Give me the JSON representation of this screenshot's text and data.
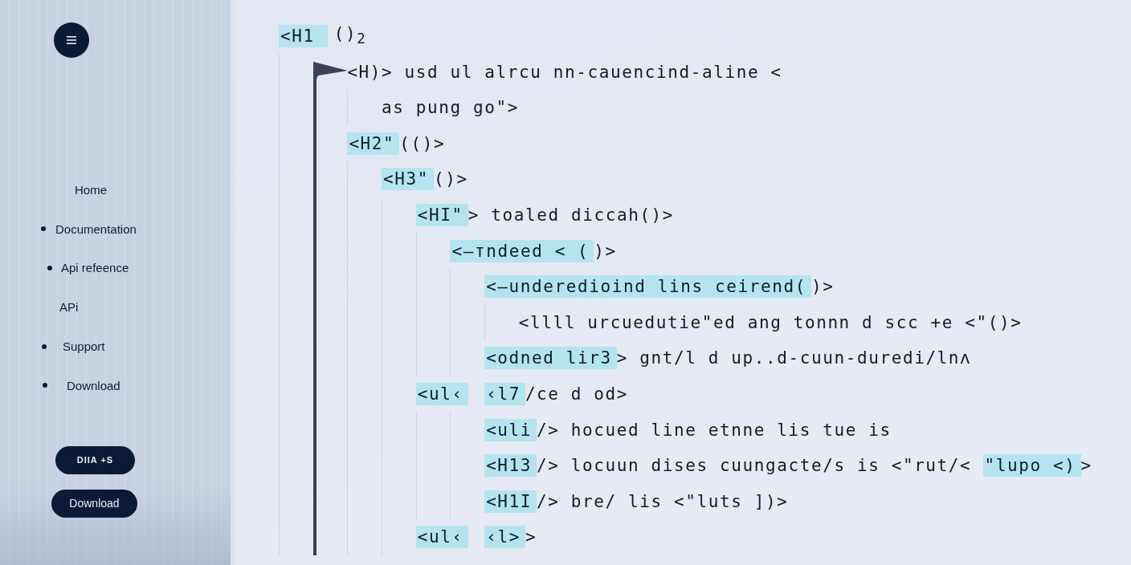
{
  "sidebar": {
    "nav": [
      {
        "label": "Home",
        "bullet": false
      },
      {
        "label": "Documentation",
        "bullet": true
      },
      {
        "label": "Api refeence",
        "bullet": true
      },
      {
        "label": "APi",
        "bullet": false
      },
      {
        "label": "Support",
        "bullet": true
      },
      {
        "label": "Download",
        "bullet": true
      }
    ],
    "buttons": [
      {
        "label": "DIIA +S"
      },
      {
        "label": "Download"
      }
    ]
  },
  "code": {
    "segments": [
      {
        "text": "<H1",
        "highlighted": true
      },
      {
        "text": "()$_{2}$",
        "highlighted": false
      }
    ],
    "children": [
      {
        "kind": "line",
        "segments": [
          {
            "text": "<H)> usd ul alrcu nn-cauencind-aline <",
            "highlighted": false
          }
        ],
        "children": [
          {
            "kind": "line",
            "segments": [
              {
                "text": "as pung go\">",
                "highlighted": false
              }
            ]
          }
        ]
      },
      {
        "kind": "line",
        "segments": [
          {
            "text": "<H2\"",
            "highlighted": true
          },
          {
            "text": "(()>",
            "highlighted": false
          }
        ],
        "children": [
          {
            "kind": "line",
            "segments": [
              {
                "text": "<H3\"",
                "highlighted": true
              },
              {
                "text": "()>",
                "highlighted": false
              }
            ],
            "children": [
              {
                "kind": "line",
                "segments": [
                  {
                    "text": "<HI\"",
                    "highlighted": true
                  },
                  {
                    "text": "> toaled diccah()>",
                    "highlighted": false
                  }
                ],
                "children": [
                  {
                    "kind": "line",
                    "segments": [
                      {
                        "text": "<—тndeed < (",
                        "highlighted": true
                      },
                      {
                        "text": ")>",
                        "highlighted": false
                      }
                    ],
                    "children": [
                      {
                        "kind": "line",
                        "segments": [
                          {
                            "text": "<—underedioind lins ceirend(",
                            "highlighted": true
                          },
                          {
                            "text": ")>",
                            "highlighted": false
                          }
                        ],
                        "children": [
                          {
                            "kind": "line",
                            "segments": [
                              {
                                "text": "<llll urcuedutie\"ed ang tonnn d scc +e <\"()>",
                                "highlighted": false
                              }
                            ]
                          }
                        ]
                      },
                      {
                        "kind": "line",
                        "segments": [
                          {
                            "text": "<odned lir3",
                            "highlighted": true
                          },
                          {
                            "text": "> gnt/l d up..d-cuun-duredi/lnʌ",
                            "highlighted": false
                          }
                        ]
                      }
                    ]
                  }
                ]
              },
              {
                "kind": "list",
                "segments": [
                  {
                    "text": "<ul‹",
                    "highlighted": true
                  },
                  {
                    "text": "‹l7",
                    "highlighted": true
                  },
                  {
                    "text": "/ce d od>",
                    "highlighted": false
                  }
                ],
                "children": [
                  {
                    "kind": "line",
                    "segments": [
                      {
                        "text": "<uli",
                        "highlighted": true
                      },
                      {
                        "text": "/> hocued line etnne lis tue is",
                        "highlighted": false
                      }
                    ]
                  },
                  {
                    "kind": "line",
                    "segments": [
                      {
                        "text": "<H13",
                        "highlighted": true
                      },
                      {
                        "text": "/> locuun dises cuungacte/s is <\"rut/< ",
                        "highlighted": false
                      },
                      {
                        "text": "\"lupo <)",
                        "highlighted": true
                      },
                      {
                        "text": ">",
                        "highlighted": false
                      }
                    ]
                  },
                  {
                    "kind": "line",
                    "segments": [
                      {
                        "text": "<H1I",
                        "highlighted": true
                      },
                      {
                        "text": "/> bre/ lis <\"luts ])>",
                        "highlighted": false
                      }
                    ]
                  }
                ]
              },
              {
                "kind": "list",
                "segments": [
                  {
                    "text": "<ul‹",
                    "highlighted": true
                  },
                  {
                    "text": "‹l>",
                    "highlighted": true
                  },
                  {
                    "text": ">",
                    "highlighted": false
                  }
                ]
              }
            ]
          }
        ]
      }
    ]
  }
}
